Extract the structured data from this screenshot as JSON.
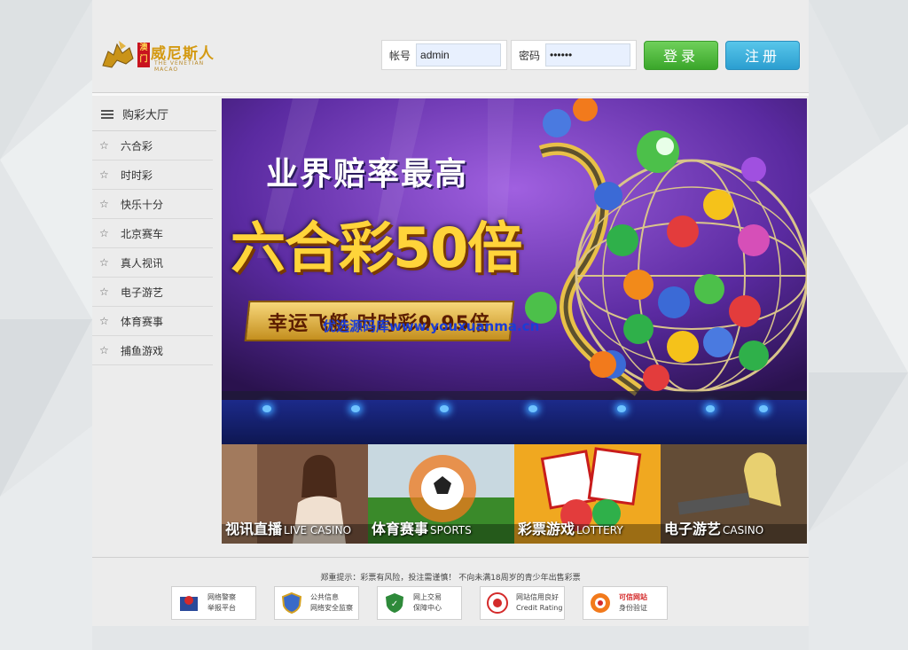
{
  "logo": {
    "badge": "澳门",
    "name": "威尼斯人",
    "sub": "THE VENETIAN MACAO"
  },
  "login": {
    "account_label": "帐号",
    "account_value": "admin",
    "password_label": "密码",
    "password_value": "••••••",
    "login_button": "登录",
    "register_button": "注册"
  },
  "sidebar": {
    "header": "购彩大厅",
    "items": [
      {
        "label": "六合彩"
      },
      {
        "label": "时时彩"
      },
      {
        "label": "快乐十分"
      },
      {
        "label": "北京赛车"
      },
      {
        "label": "真人视讯"
      },
      {
        "label": "电子游艺"
      },
      {
        "label": "体育赛事"
      },
      {
        "label": "捕鱼游戏"
      }
    ]
  },
  "banner": {
    "title": "业界赔率最高",
    "headline": "六合彩50倍",
    "ribbon": "幸运飞艇 时时彩9.95倍",
    "watermark": "优选源码库www.youxuanma.cn"
  },
  "cards": [
    {
      "cn": "视讯直播",
      "en": "LIVE CASINO"
    },
    {
      "cn": "体育赛事",
      "en": "SPORTS"
    },
    {
      "cn": "彩票游戏",
      "en": "LOTTERY"
    },
    {
      "cn": "电子游艺",
      "en": "CASINO"
    }
  ],
  "footer": {
    "notice": "郑重提示：彩票有风险，投注需谨慎！ 不向未满18周岁的青少年出售彩票",
    "badges": [
      {
        "line1": "网络警察",
        "line2": "举报平台"
      },
      {
        "line1": "公共信息",
        "line2": "网络安全监察"
      },
      {
        "line1": "网上交易",
        "line2": "保障中心"
      },
      {
        "line1": "网站信用良好",
        "line2": "Credit Rating"
      },
      {
        "line1": "可信网站",
        "line2": "身份验证"
      }
    ]
  },
  "colors": {
    "login_green": "#3aa62a",
    "register_blue": "#2b9ed0",
    "banner_purple": "#5a2aa0",
    "gold": "#ffd43a"
  }
}
